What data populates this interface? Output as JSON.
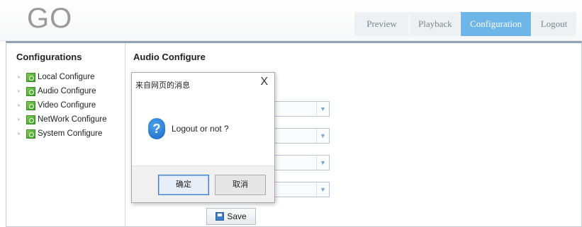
{
  "header": {
    "logo": "GO",
    "nav": [
      {
        "label": "Preview",
        "active": false
      },
      {
        "label": "Playback",
        "active": false
      },
      {
        "label": "Configuration",
        "active": true
      },
      {
        "label": "Logout",
        "active": false
      }
    ]
  },
  "sidebar": {
    "title": "Configurations",
    "items": [
      {
        "label": "Local Configure",
        "icon": "config-icon"
      },
      {
        "label": "Audio Configure",
        "icon": "config-icon"
      },
      {
        "label": "Video Configure",
        "icon": "config-icon"
      },
      {
        "label": "NetWork Configure",
        "icon": "config-icon"
      },
      {
        "label": "System Configure",
        "icon": "config-icon"
      }
    ]
  },
  "main": {
    "title": "Audio Configure",
    "save_label": "Save"
  },
  "dialog": {
    "title": "来自网页的消息",
    "close": "X",
    "icon_glyph": "?",
    "message": "Logout or not ?",
    "ok_label": "确定",
    "cancel_label": "取消"
  },
  "colors": {
    "accent": "#6fb6e8",
    "tree_icon": "#4aa32f"
  }
}
